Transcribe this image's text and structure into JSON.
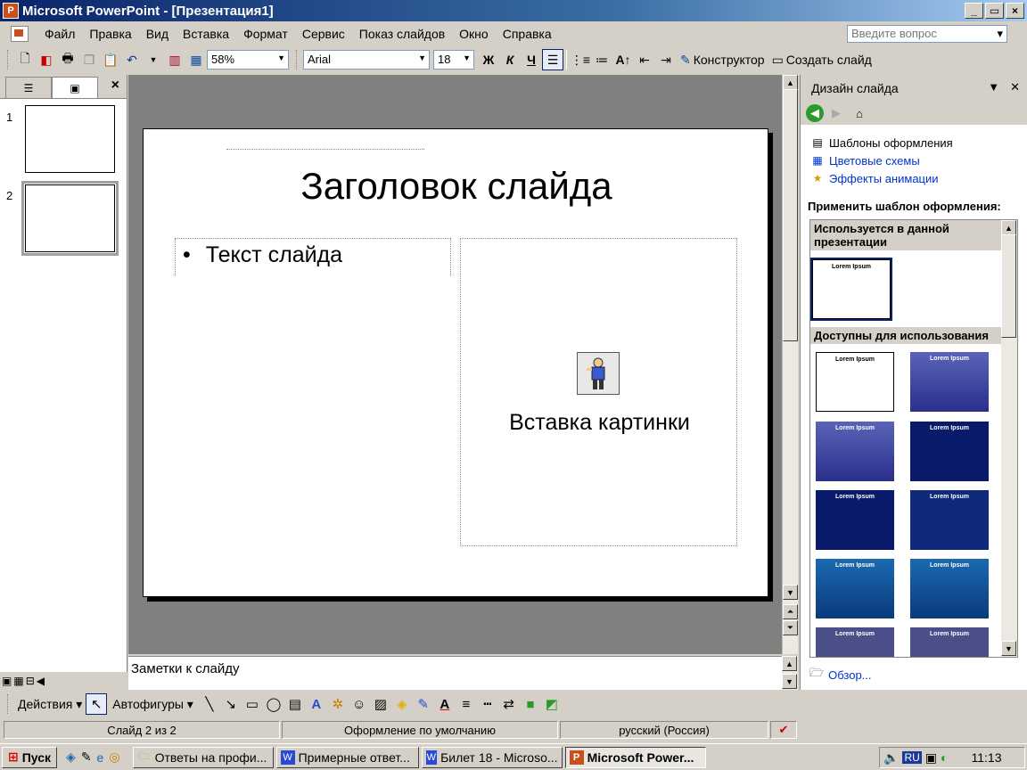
{
  "window": {
    "title": "Microsoft PowerPoint - [Презентация1]",
    "buttons": [
      "_",
      "▭",
      "×"
    ]
  },
  "menu": {
    "items": [
      "Файл",
      "Правка",
      "Вид",
      "Вставка",
      "Формат",
      "Сервис",
      "Показ слайдов",
      "Окно",
      "Справка"
    ],
    "ask_placeholder": "Введите вопрос"
  },
  "toolbar": {
    "zoom": "58%",
    "font": "Arial",
    "font_size": "18",
    "bold": "Ж",
    "italic": "К",
    "underline": "Ч",
    "designer_label": "Конструктор",
    "new_slide_label": "Создать слайд"
  },
  "left_panel": {
    "slides": [
      "1",
      "2"
    ],
    "selected": 2
  },
  "slide": {
    "title": "Заголовок слайда",
    "bullet": "•",
    "text": "Текст слайда",
    "picture_label": "Вставка картинки"
  },
  "notes": {
    "placeholder": "Заметки к слайду"
  },
  "task_pane": {
    "title": "Дизайн слайда",
    "links": [
      {
        "label": "Шаблоны оформления",
        "icon": "templates-icon"
      },
      {
        "label": "Цветовые схемы",
        "icon": "color-scheme-icon"
      },
      {
        "label": "Эффекты анимации",
        "icon": "animation-icon"
      }
    ],
    "apply_label": "Применить шаблон оформления:",
    "used_header": "Используется в данной презентации",
    "available_header": "Доступны для использования",
    "template_title": "Lorem Ipsum",
    "browse": "Обзор..."
  },
  "draw_toolbar": {
    "actions": "Действия",
    "autoshapes": "Автофигуры"
  },
  "status": {
    "slide": "Слайд 2 из 2",
    "design": "Оформление по умолчанию",
    "language": "русский (Россия)"
  },
  "taskbar": {
    "start": "Пуск",
    "tasks": [
      "Ответы на профи...",
      "Примерные ответ...",
      "Билет 18 - Microso...",
      "Microsoft Power..."
    ],
    "lang": "RU",
    "time": "11:13"
  }
}
